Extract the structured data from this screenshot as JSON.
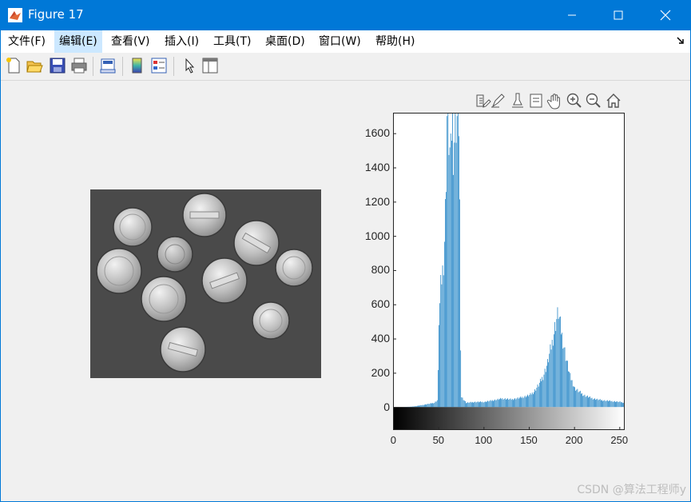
{
  "window": {
    "title": "Figure 17"
  },
  "menu": {
    "items": [
      "文件(F)",
      "编辑(E)",
      "查看(V)",
      "插入(I)",
      "工具(T)",
      "桌面(D)",
      "窗口(W)",
      "帮助(H)"
    ],
    "active_index": 1
  },
  "toolbar": {
    "buttons": [
      "new-figure-icon",
      "open-file-icon",
      "save-icon",
      "print-icon",
      "link-plot-icon",
      "colorbar-icon",
      "legend-icon",
      "edit-plot-arrow-icon",
      "property-inspector-icon"
    ]
  },
  "axes_toolbar": {
    "buttons": [
      "export-icon",
      "brush-icon",
      "data-cursor-icon",
      "data-tips-icon",
      "pan-hand-icon",
      "zoom-in-icon",
      "zoom-out-icon",
      "home-icon"
    ]
  },
  "chart_data": {
    "type": "bar",
    "title": "",
    "xlabel": "",
    "ylabel": "",
    "xlim": [
      0,
      255
    ],
    "ylim": [
      -130,
      1720
    ],
    "yticks": [
      0,
      200,
      400,
      600,
      800,
      1000,
      1200,
      1400,
      1600
    ],
    "xticks": [
      0,
      50,
      100,
      150,
      200,
      250
    ],
    "bar_color": "#0072bd",
    "colorbar": "grayscale 0-255",
    "profile": [
      [
        0,
        0
      ],
      [
        10,
        0
      ],
      [
        20,
        2
      ],
      [
        25,
        6
      ],
      [
        30,
        10
      ],
      [
        35,
        15
      ],
      [
        40,
        20
      ],
      [
        45,
        25
      ],
      [
        48,
        40
      ],
      [
        49,
        200
      ],
      [
        50,
        520
      ],
      [
        51,
        600
      ],
      [
        52,
        700
      ],
      [
        53,
        760
      ],
      [
        54,
        800
      ],
      [
        55,
        880
      ],
      [
        56,
        1000
      ],
      [
        57,
        1150
      ],
      [
        58,
        1400
      ],
      [
        59,
        1720
      ],
      [
        60,
        1720
      ],
      [
        61,
        1600
      ],
      [
        62,
        1500
      ],
      [
        63,
        1450
      ],
      [
        64,
        1650
      ],
      [
        65,
        1720
      ],
      [
        66,
        1550
      ],
      [
        67,
        1600
      ],
      [
        68,
        1720
      ],
      [
        69,
        1720
      ],
      [
        70,
        1720
      ],
      [
        71,
        1720
      ],
      [
        72,
        1720
      ],
      [
        73,
        1200
      ],
      [
        74,
        300
      ],
      [
        75,
        60
      ],
      [
        80,
        25
      ],
      [
        90,
        30
      ],
      [
        100,
        30
      ],
      [
        110,
        40
      ],
      [
        120,
        50
      ],
      [
        130,
        45
      ],
      [
        140,
        55
      ],
      [
        150,
        70
      ],
      [
        155,
        90
      ],
      [
        160,
        130
      ],
      [
        165,
        180
      ],
      [
        170,
        260
      ],
      [
        175,
        380
      ],
      [
        178,
        470
      ],
      [
        180,
        520
      ],
      [
        182,
        560
      ],
      [
        184,
        480
      ],
      [
        186,
        420
      ],
      [
        188,
        360
      ],
      [
        190,
        300
      ],
      [
        192,
        250
      ],
      [
        195,
        180
      ],
      [
        200,
        110
      ],
      [
        210,
        70
      ],
      [
        220,
        50
      ],
      [
        230,
        40
      ],
      [
        240,
        35
      ],
      [
        250,
        30
      ],
      [
        255,
        25
      ]
    ]
  },
  "image_panel": {
    "caption": ""
  },
  "watermark": "CSDN @算法工程师y"
}
